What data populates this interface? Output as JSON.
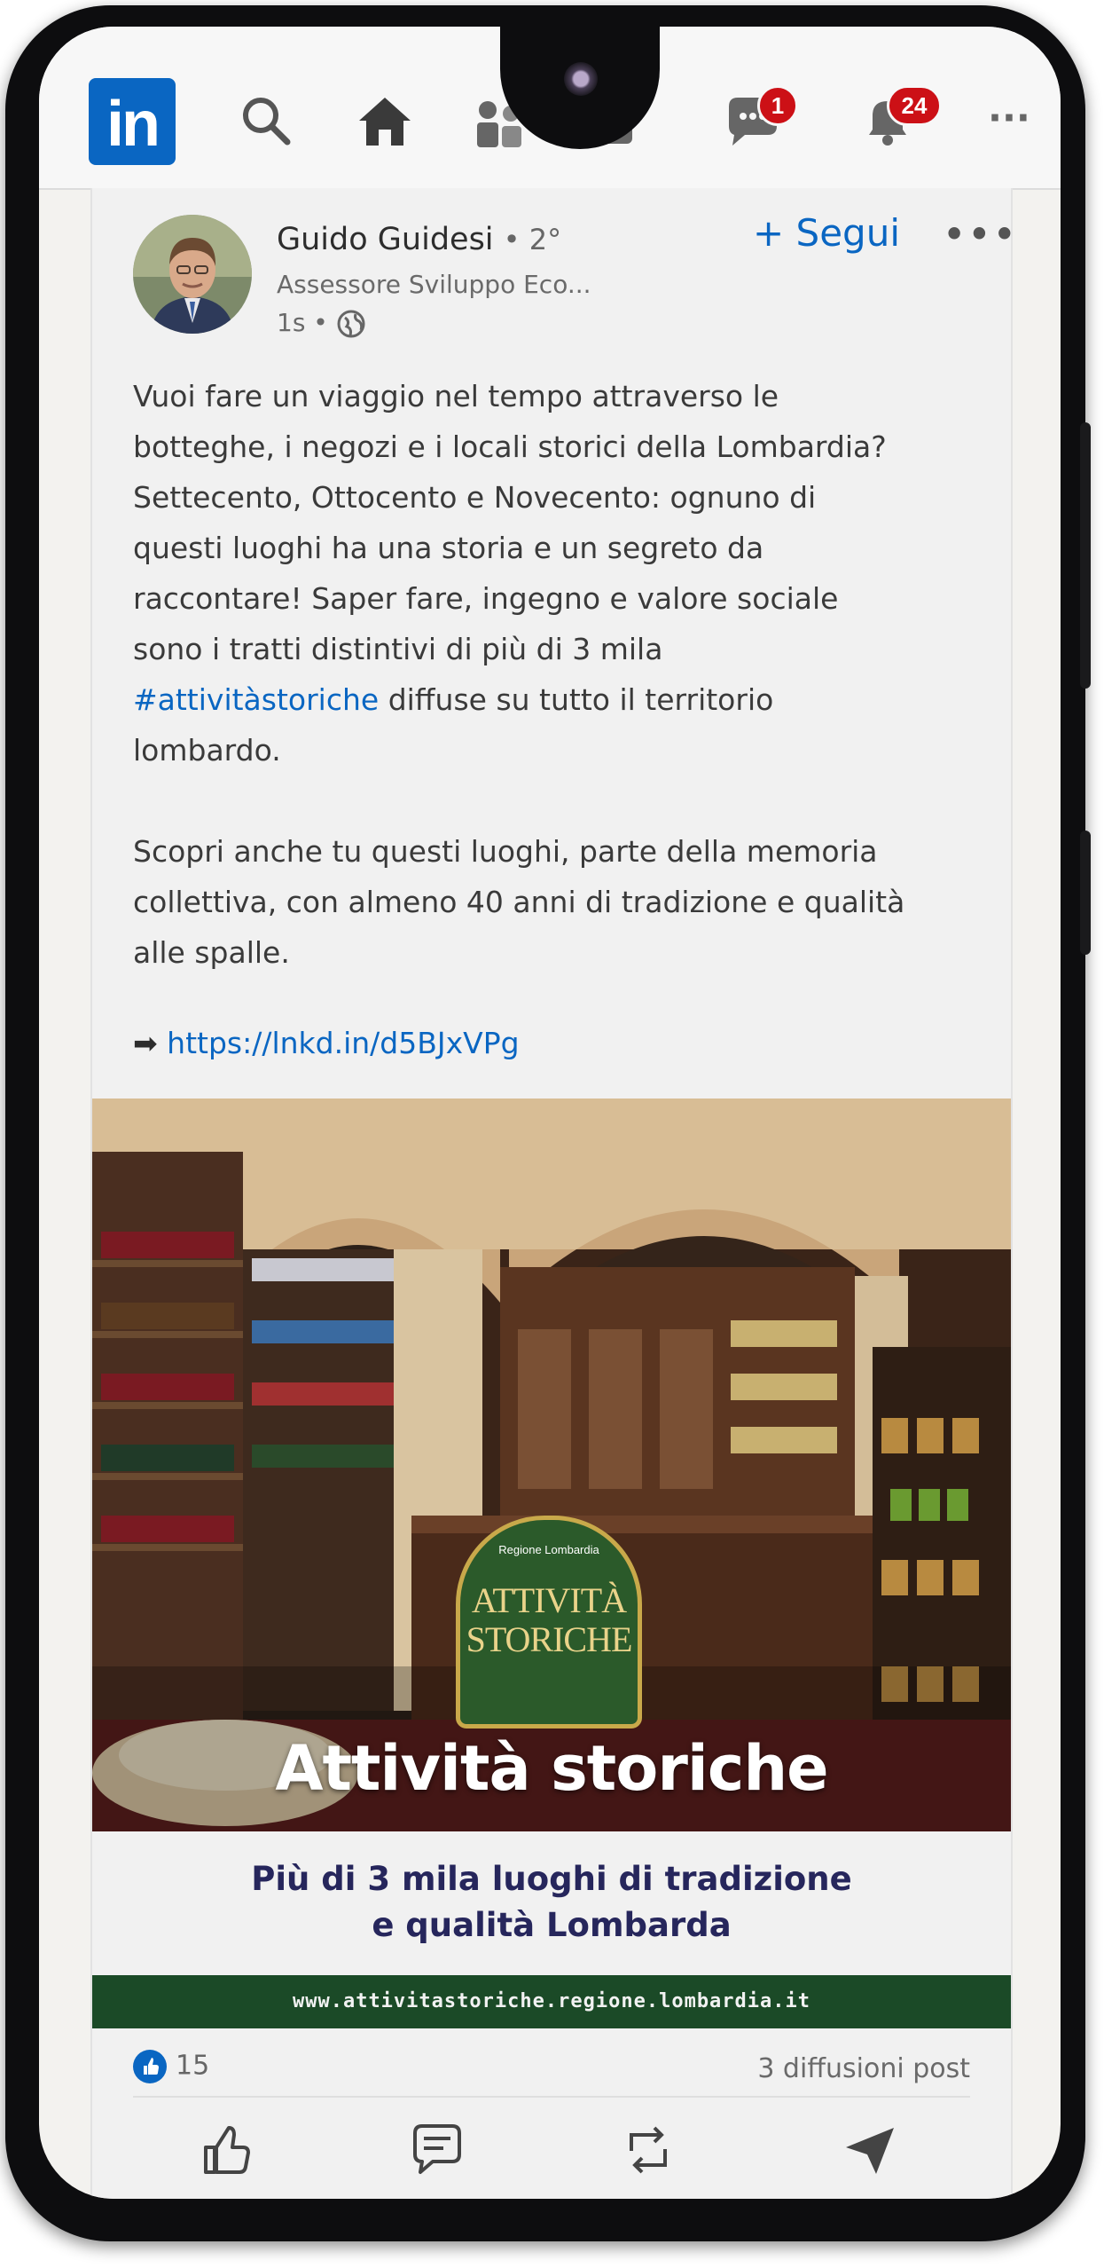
{
  "nav": {
    "logo_text": "in",
    "icons": [
      "search-icon",
      "home-icon",
      "my-network-icon",
      "jobs-icon",
      "messaging-icon",
      "notifications-icon",
      "more-icon"
    ],
    "messaging_badge": "1",
    "notifications_badge": "24",
    "more_label": "···"
  },
  "post": {
    "author_name": "Guido Guidesi",
    "author_degree": "• 2°",
    "author_title": "Assessore Sviluppo Eco...",
    "time": "1s •",
    "follow_label": "+ Segui",
    "more_label": "•••",
    "text_part1": "Vuoi fare un viaggio nel tempo attraverso le\nbotteghe, i negozi e i locali storici della Lombardia?\nSettecento, Ottocento e Novecento: ognuno di\nquesti luoghi ha una storia e un segreto da\nraccontare! Saper fare, ingegno e valore sociale\nsono i tratti distintivi di più di 3 mila\n",
    "hashtag": "#attivitàstoriche",
    "text_part2": " diffuse su tutto il territorio\nlombardo.\n\nScopri anche tu questi luoghi, parte della memoria\ncollettiva, con almeno 40 anni di tradizione e qualità\nalle spalle.",
    "link_arrow": "➡",
    "link_url": "https://lnkd.in/d5BJxVPg"
  },
  "media": {
    "badge_top": "Regione Lombardia",
    "badge_line1": "ATTIVITÀ",
    "badge_line2": "STORICHE",
    "overlay_title": "Attività storiche",
    "caption_line1": "Più di 3 mila luoghi di tradizione",
    "caption_line2": "e qualità Lombarda",
    "website": "www.attivitastoriche.regione.lombardia.it"
  },
  "stats": {
    "likes": "15",
    "shares": "3 diffusioni post"
  },
  "actions": [
    "like-icon",
    "comment-icon",
    "repost-icon",
    "send-icon"
  ],
  "colors": {
    "accent": "#0a66c2",
    "badge": "#cc1016",
    "band": "#1b4a27",
    "caption": "#26265c"
  }
}
